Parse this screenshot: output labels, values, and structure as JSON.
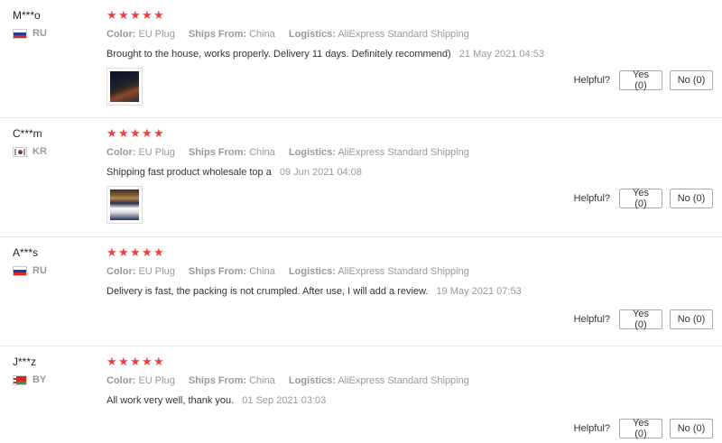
{
  "reviews": [
    {
      "user": "M***o",
      "country": "RU",
      "flag": "russia-flag-icon",
      "rating": 5,
      "color_label": "Color:",
      "color_value": "EU Plug",
      "ships_label": "Ships From:",
      "ships_value": "China",
      "logistics_label": "Logistics:",
      "logistics_value": "AliExpress Standard Shipping",
      "text": "Brought to the house, works properly. Delivery 11 days. Definitely recommend)",
      "date": "21 May 2021 04:53",
      "helpful_label": "Helpful?",
      "yes_label": "Yes (0)",
      "no_label": "No (0)"
    },
    {
      "user": "C***m",
      "country": "KR",
      "flag": "south-korea-flag-icon",
      "rating": 5,
      "color_label": "Color:",
      "color_value": "EU Plug",
      "ships_label": "Ships From:",
      "ships_value": "China",
      "logistics_label": "Logistics:",
      "logistics_value": "AliExpress Standard Shipping",
      "text": "Shipping fast product wholesale top a",
      "date": "09 Jun 2021 04:08",
      "helpful_label": "Helpful?",
      "yes_label": "Yes (0)",
      "no_label": "No (0)"
    },
    {
      "user": "A***s",
      "country": "RU",
      "flag": "russia-flag-icon",
      "rating": 5,
      "color_label": "Color:",
      "color_value": "EU Plug",
      "ships_label": "Ships From:",
      "ships_value": "China",
      "logistics_label": "Logistics:",
      "logistics_value": "AliExpress Standard Shipping",
      "text": "Delivery is fast, the packing is not crumpled. After use, I will add a review.",
      "date": "19 May 2021 07:53",
      "helpful_label": "Helpful?",
      "yes_label": "Yes (0)",
      "no_label": "No (0)"
    },
    {
      "user": "J***z",
      "country": "BY",
      "flag": "belarus-flag-icon",
      "rating": 5,
      "color_label": "Color:",
      "color_value": "EU Plug",
      "ships_label": "Ships From:",
      "ships_value": "China",
      "logistics_label": "Logistics:",
      "logistics_value": "AliExpress Standard Shipping",
      "text": "All work very well, thank you.",
      "date": "01 Sep 2021 03:03",
      "helpful_label": "Helpful?",
      "yes_label": "Yes (0)",
      "no_label": "No (0)"
    }
  ],
  "colors": {
    "star": "#f03d3d",
    "muted": "#999999",
    "text": "#333333",
    "divider": "#e8e8e8"
  }
}
